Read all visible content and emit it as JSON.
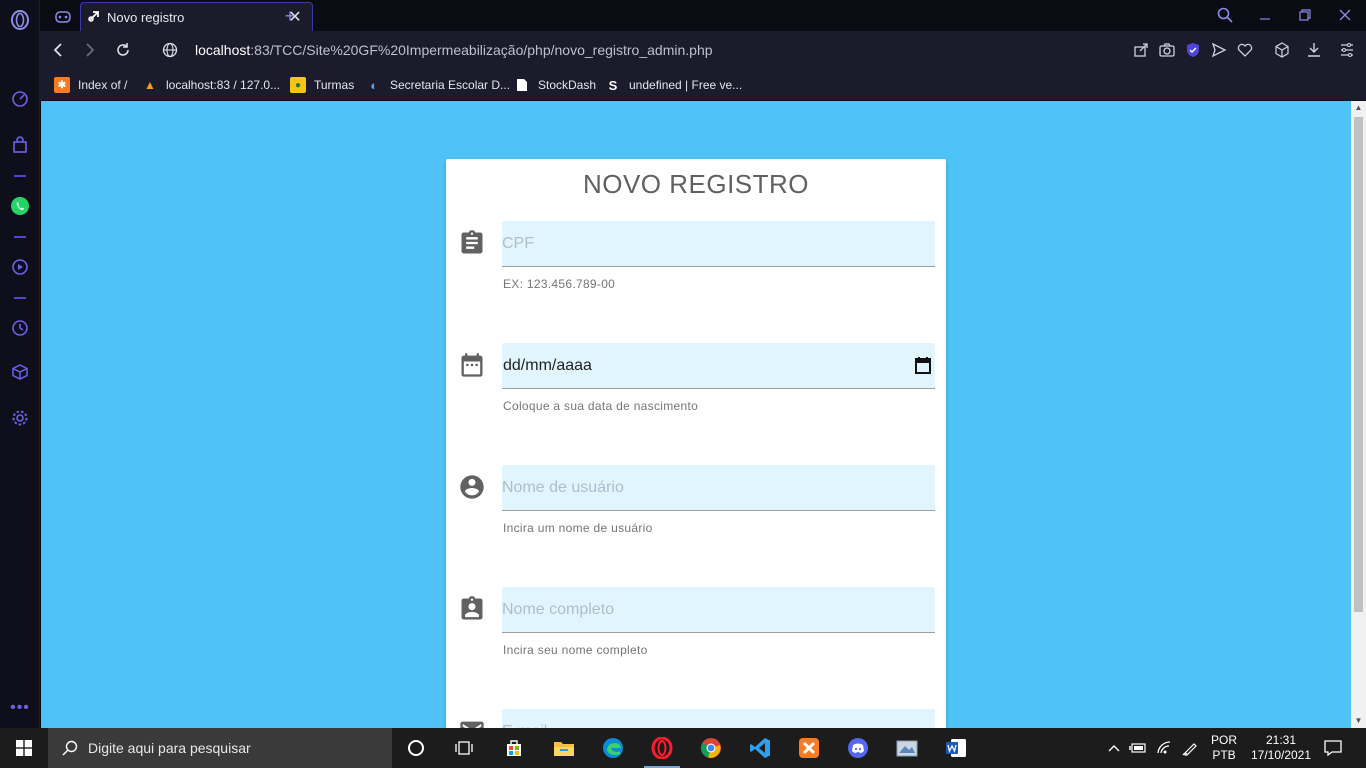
{
  "browser": {
    "tab_title": "Novo registro",
    "url_host": "localhost",
    "url_rest": ":83/TCC/Site%20GF%20Impermeabilização/php/novo_registro_admin.php"
  },
  "bookmarks": [
    {
      "label": "Index of /",
      "icon": "xampp-icon",
      "color": "#fb7a24"
    },
    {
      "label": "localhost:83 / 127.0...",
      "icon": "phpmyadmin-icon",
      "color": "#f89c0e"
    },
    {
      "label": "Turmas",
      "icon": "classroom-icon",
      "color": "#f9c513"
    },
    {
      "label": "Secretaria Escolar D...",
      "icon": "secretaria-icon",
      "color": "#5aa0e8"
    },
    {
      "label": "StockDash",
      "icon": "document-icon",
      "color": "#ffffff"
    },
    {
      "label": "undefined | Free ve...",
      "icon": "s-logo-icon",
      "color": "#ffffff"
    }
  ],
  "form": {
    "title": "NOVO REGISTRO",
    "fields": [
      {
        "placeholder": "CPF",
        "helper": "EX: 123.456.789-00",
        "icon": "assignment-icon"
      },
      {
        "value": "dd/mm/aaaa",
        "helper": "Coloque a sua data de nascimento",
        "icon": "calendar-icon"
      },
      {
        "placeholder": "Nome de usuário",
        "helper": "Incira um nome de usuário",
        "icon": "account-circle-icon"
      },
      {
        "placeholder": "Nome completo",
        "helper": "Incira seu nome completo",
        "icon": "assignment-ind-icon"
      },
      {
        "placeholder": "E-mail",
        "helper": "",
        "icon": "email-icon"
      }
    ]
  },
  "taskbar": {
    "search_placeholder": "Digite aqui para pesquisar",
    "lang_line1": "POR",
    "lang_line2": "PTB",
    "time": "21:31",
    "date": "17/10/2021"
  },
  "colors": {
    "page_bg": "#4fc3f7",
    "input_bg": "#e1f5fe",
    "accent": "#4e46d8"
  }
}
